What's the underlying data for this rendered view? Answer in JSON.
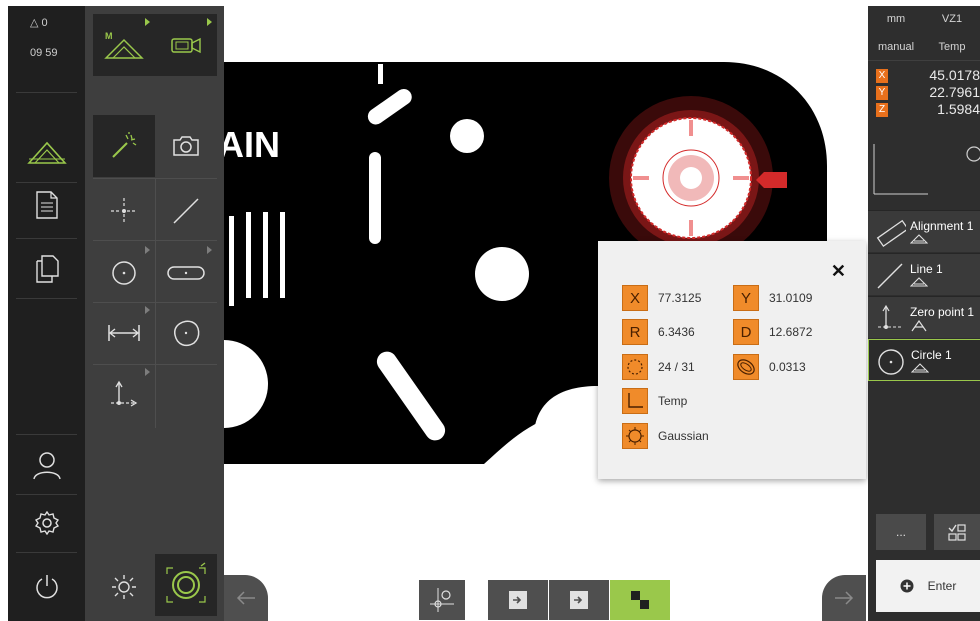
{
  "status": {
    "delta": "0",
    "time": "09 59"
  },
  "right_header": {
    "unit": "mm",
    "zone": "VZ1",
    "mode": "manual",
    "coord": "Temp"
  },
  "positions": [
    {
      "axis": "X",
      "value": "45.0178"
    },
    {
      "axis": "Y",
      "value": "22.7961"
    },
    {
      "axis": "Z",
      "value": "1.5984"
    }
  ],
  "features": [
    {
      "name": "Alignment 1"
    },
    {
      "name": "Line 1"
    },
    {
      "name": "Zero point 1"
    },
    {
      "name": "Circle 1"
    }
  ],
  "buttons": {
    "more": "...",
    "enter": "Enter"
  },
  "canvas": {
    "label": "AIN"
  },
  "result": {
    "x_label": "X",
    "x_value": "77.3125",
    "y_label": "Y",
    "y_value": "31.0109",
    "r_label": "R",
    "r_value": "6.3436",
    "d_label": "D",
    "d_value": "12.6872",
    "points": "24 / 31",
    "form": "0.0313",
    "coord_system": "Temp",
    "fit": "Gaussian"
  },
  "colors": {
    "accent_green": "#9ac84b",
    "badge_orange": "#f08b2a",
    "axis_orange": "#e8701c",
    "circle_red": "#d42a2a"
  }
}
